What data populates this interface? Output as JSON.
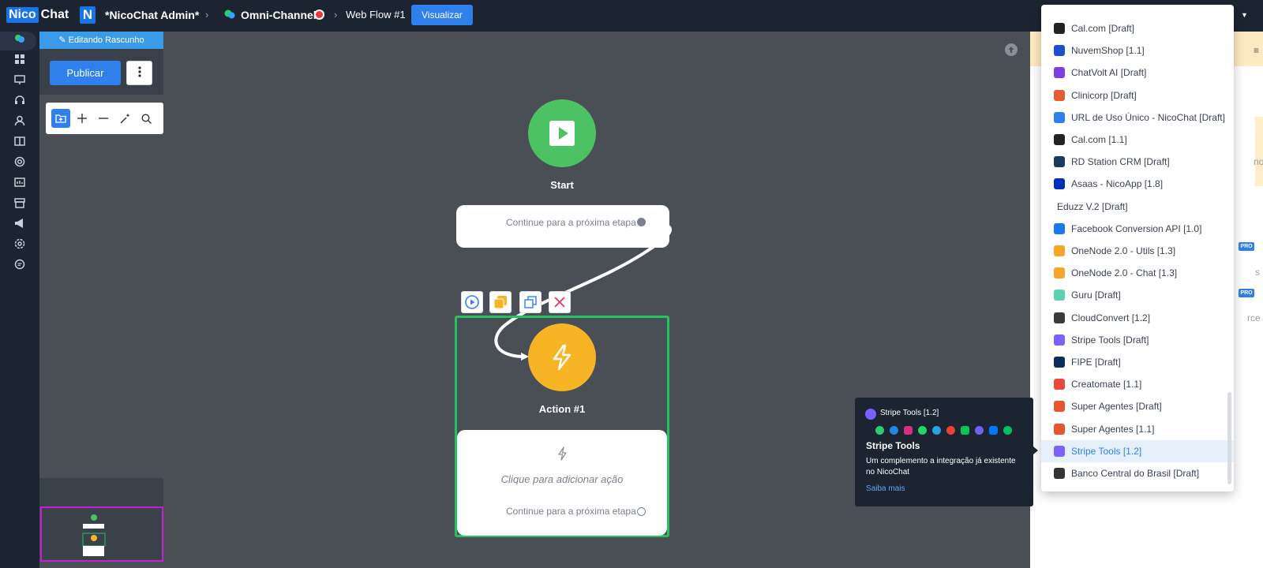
{
  "topbar": {
    "logo_nico": "Nico",
    "logo_chat": "Chat",
    "workspace_badge": "N",
    "workspace_name": "*NicoChat Admin*",
    "channel": "Omni-Channel",
    "flow_name": "Web Flow #1",
    "view_button": "Visualizar"
  },
  "draft_panel": {
    "banner": "Editando Rascunho",
    "publish_button": "Publicar"
  },
  "canvas": {
    "start_node": {
      "label": "Start",
      "continue_text": "Continue para a próxima etapa"
    },
    "action_node": {
      "label": "Action #1",
      "add_action_text": "Clique para adicionar ação",
      "continue_text": "Continue para a próxima etapa"
    }
  },
  "integrations_dropdown": {
    "items": [
      {
        "label": "Cal.com [Draft]",
        "icon": "calcom-icon",
        "color": "#222222"
      },
      {
        "label": "NuvemShop [1.1]",
        "icon": "nuvemshop-icon",
        "color": "#1f4fcc"
      },
      {
        "label": "ChatVolt AI [Draft]",
        "icon": "chatvolt-icon",
        "color": "#7b3fe4"
      },
      {
        "label": "Clinicorp [Draft]",
        "icon": "clinicorp-icon",
        "color": "#e65c2e"
      },
      {
        "label": "URL de Uso Único - NicoChat [Draft]",
        "icon": "link-icon",
        "color": "#2f80ed"
      },
      {
        "label": "Cal.com [1.1]",
        "icon": "calcom-icon",
        "color": "#222222"
      },
      {
        "label": "RD Station CRM [Draft]",
        "icon": "rdstation-icon",
        "color": "#1c3a5e"
      },
      {
        "label": "Asaas - NicoApp [1.8]",
        "icon": "asaas-icon",
        "color": "#0030b9"
      },
      {
        "label": "Eduzz V.2 [Draft]",
        "icon": "",
        "color": ""
      },
      {
        "label": "Facebook Conversion API [1.0]",
        "icon": "facebook-icon",
        "color": "#1877f2"
      },
      {
        "label": "OneNode 2.0 - Utils [1.3]",
        "icon": "onenode-icon",
        "color": "#f4a52a"
      },
      {
        "label": "OneNode 2.0 - Chat [1.3]",
        "icon": "onenode-icon",
        "color": "#f4a52a"
      },
      {
        "label": "Guru [Draft]",
        "icon": "guru-icon",
        "color": "#5ad1b3"
      },
      {
        "label": "CloudConvert [1.2]",
        "icon": "cloudconvert-icon",
        "color": "#3a3a3a"
      },
      {
        "label": "Stripe Tools [Draft]",
        "icon": "stripe-icon",
        "color": "#7b61ff"
      },
      {
        "label": "FIPE [Draft]",
        "icon": "fipe-icon",
        "color": "#0b2e5c"
      },
      {
        "label": "Creatomate [1.1]",
        "icon": "creatomate-icon",
        "color": "#ea4a3c"
      },
      {
        "label": "Super Agentes [Draft]",
        "icon": "superagentes-icon",
        "color": "#e8542c"
      },
      {
        "label": "Super Agentes [1.1]",
        "icon": "superagentes-icon",
        "color": "#e8542c"
      },
      {
        "label": "Stripe Tools [1.2]",
        "icon": "stripe-icon",
        "color": "#7b61ff",
        "selected": true
      },
      {
        "label": "Banco Central do Brasil [Draft]",
        "icon": "bcb-icon",
        "color": "#333333"
      }
    ]
  },
  "tooltip": {
    "header": "Stripe Tools [1.2]",
    "name": "Stripe Tools",
    "description": "Um complemento a integração já existente no NicoChat",
    "link": "Saiba mais"
  },
  "right_panel": {
    "pro_badge": "PRO",
    "frag_1": "no",
    "frag_2": "s",
    "frag_3": "rce"
  }
}
